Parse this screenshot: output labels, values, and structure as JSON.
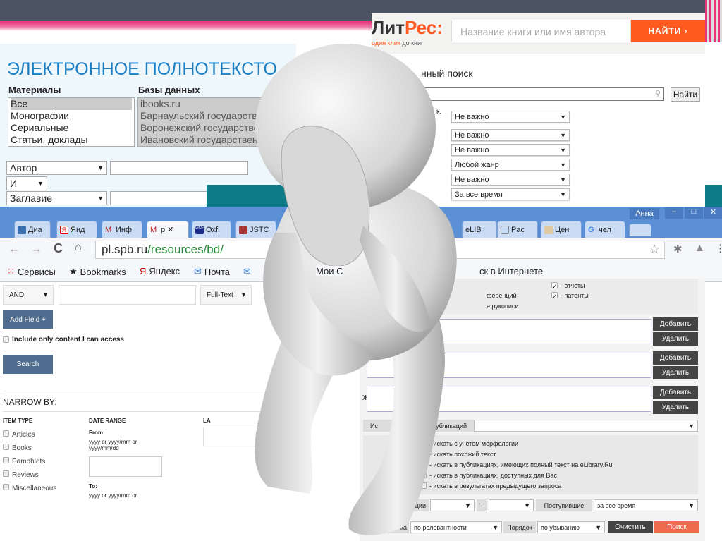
{
  "elib": {
    "title": "ЭЛЕКТРОННОЕ ПОЛНОТЕКСТО",
    "materials_label": "Материалы",
    "materials": [
      "Все",
      "Монографии",
      "Сериальные",
      "Статьи, доклады"
    ],
    "db_label": "Базы данных",
    "databases": [
      "ibooks.ru",
      "Барнаульский государств",
      "Воронежский государстве",
      "Ивановский государствен"
    ],
    "field1": "Автор",
    "operator": "И",
    "field2": "Заглавие"
  },
  "litres": {
    "logo_a": "Лит",
    "logo_b": "Рес:",
    "tagline_a": "один клик",
    "tagline_b": " до книг",
    "search_placeholder": "Название книги или имя автора",
    "search_button": "НАЙТИ ›",
    "adv_title": "нный поиск",
    "find_button": "Найти",
    "label_fragment": "к.",
    "selects": [
      "Не важно",
      "Не важно",
      "Не важно",
      "Любой жанр",
      "Не важно",
      "За все время"
    ]
  },
  "chrome": {
    "user": "Анна",
    "tabs": [
      "Диа",
      "Янд",
      "Инф",
      "p",
      "Oxf",
      "JSTC",
      "",
      "eLIB",
      "Pac",
      "Цен",
      "чел"
    ],
    "url_host": "pl.spb.ru",
    "url_path": "/resources/bd/",
    "bookmarks": [
      "Сервисы",
      "Bookmarks",
      "Яндекс",
      "Почта",
      "Мои С",
      "ск в Интернете"
    ]
  },
  "jstor": {
    "operator": "AND",
    "field_type": "Full-Text",
    "add_field": "Add Field +",
    "include_label": "Include only content I can access",
    "search": "Search",
    "narrow_by": "NARROW BY:",
    "item_type_label": "ITEM TYPE",
    "item_types": [
      "Articles",
      "Books",
      "Pamphlets",
      "Reviews",
      "Miscellaneous"
    ],
    "date_range_label": "DATE RANGE",
    "from_label": "From:",
    "from_hint": "yyyy or yyyy/mm or yyyy/mm/dd",
    "to_label": "To:",
    "to_hint": "yyyy or yyyy/mm or",
    "lang_fragment": "LA"
  },
  "elibrary": {
    "checks": [
      {
        "label": "- отчеты",
        "checked": true
      },
      {
        "label": "- патенты",
        "checked": true
      }
    ],
    "frag1": "ференций",
    "frag2": "е рукописи",
    "add": "Добавить",
    "remove": "Удалить",
    "journal_frag": "Жур",
    "pub_type_frag": "Ис",
    "pub_type_label": "публикаций",
    "options": [
      {
        "label": "- искать с учетом морфологии",
        "checked": true
      },
      {
        "label": "- искать похожий текст",
        "checked": false
      },
      {
        "label": "- искать в публикациях, имеющих полный текст на eLibrary.Ru",
        "checked": false
      },
      {
        "label": "- искать в публикациях, доступных для Вас",
        "checked": false
      },
      {
        "label": "- искать в результатах предыдущего запроса",
        "checked": false
      }
    ],
    "years_frag": "кации",
    "dash": "-",
    "received_label": "Поступившие",
    "received_value": "за все время",
    "sort_frag": "ка",
    "sort_value": "по релевантности",
    "order_label": "Порядок",
    "order_value": "по убыванию",
    "clear": "Очистить",
    "search": "Поиск"
  }
}
